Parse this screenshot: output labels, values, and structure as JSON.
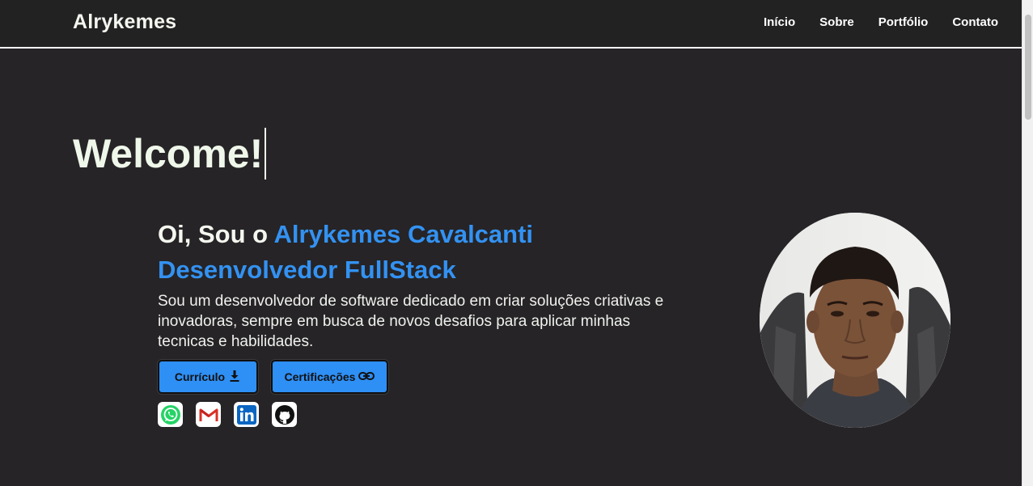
{
  "header": {
    "brand": "Alrykemes",
    "nav": [
      "Início",
      "Sobre",
      "Portfólio",
      "Contato"
    ]
  },
  "welcome": {
    "text": "Welcome!"
  },
  "hero": {
    "greeting_prefix": "Oi, Sou o ",
    "name": "Alrykemes Cavalcanti",
    "role": "Desenvolvedor FullStack",
    "description": "Sou um desenvolvedor de software dedicado em criar soluções criativas e inovadoras, sempre em busca de novos desafios para aplicar minhas tecnicas e habilidades.",
    "buttons": {
      "cv_label": "Currículo",
      "cv_icon": "download-icon",
      "cert_label": "Certificações",
      "cert_icon": "link-icon"
    },
    "socials": [
      "whatsapp-icon",
      "gmail-icon",
      "linkedin-icon",
      "github-icon"
    ]
  },
  "colors": {
    "background": "#262426",
    "accent": "#3392f2",
    "button": "#2e8ff5",
    "text": "#f0f2ee"
  }
}
